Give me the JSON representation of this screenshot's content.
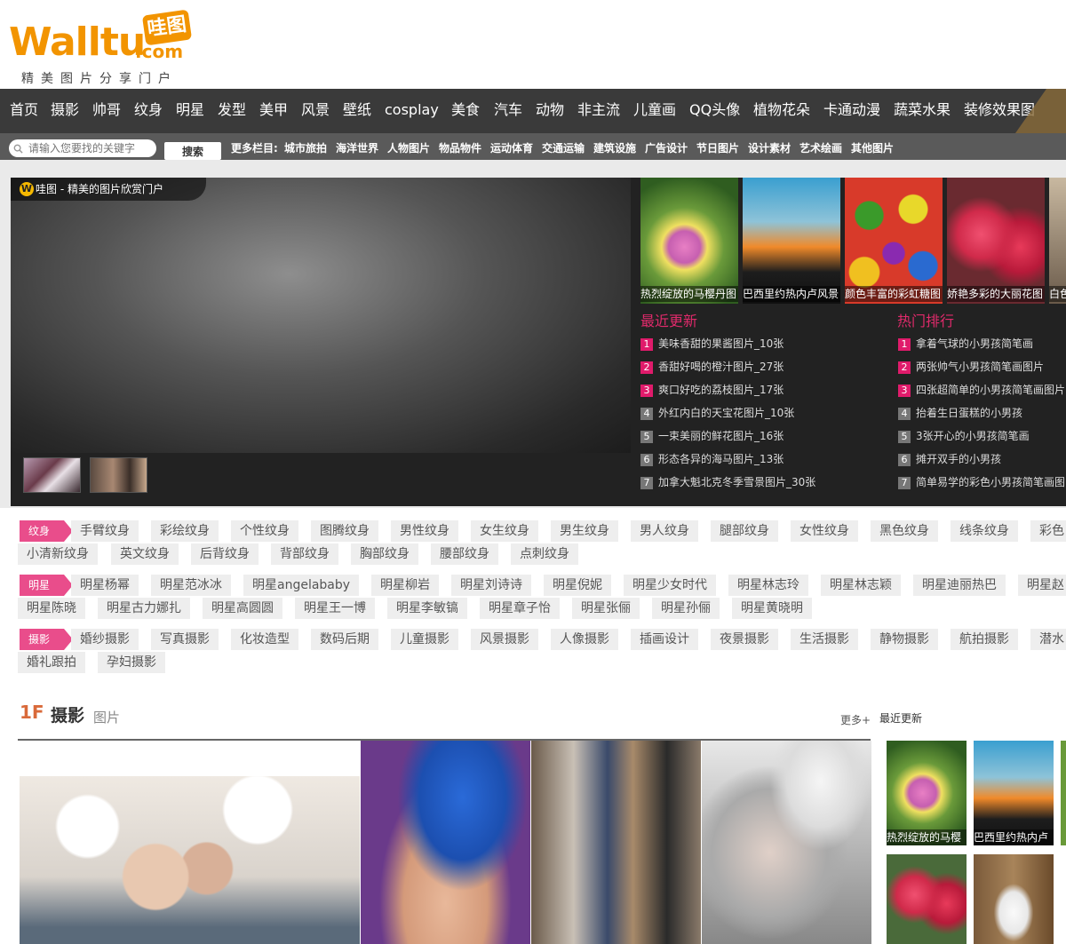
{
  "logo": {
    "word": "Walltu",
    "com": ".com",
    "badge": "哇图",
    "slogan": "精美图片分享门户"
  },
  "nav": {
    "items": [
      "首页",
      "摄影",
      "帅哥",
      "纹身",
      "明星",
      "发型",
      "美甲",
      "风景",
      "壁纸",
      "cosplay",
      "美食",
      "汽车",
      "动物",
      "非主流",
      "儿童画",
      "QQ头像",
      "植物花朵",
      "卡通动漫",
      "蔬菜水果",
      "装修效果图"
    ]
  },
  "search": {
    "placeholder": "请输入您要找的关键字",
    "button": "搜索"
  },
  "more": {
    "label": "更多栏目:",
    "links": [
      "城市旅拍",
      "海洋世界",
      "人物图片",
      "物品物件",
      "运动体育",
      "交通运输",
      "建筑设施",
      "广告设计",
      "节日图片",
      "设计素材",
      "艺术绘画",
      "其他图片"
    ]
  },
  "featured": {
    "badge": "W",
    "title": "哇图 - 精美的图片欣赏门户"
  },
  "top_cards": [
    {
      "caption": "热烈绽放的马樱丹图"
    },
    {
      "caption": "巴西里约热内卢风景"
    },
    {
      "caption": "颜色丰富的彩虹糖图"
    },
    {
      "caption": "娇艳多彩的大丽花图"
    },
    {
      "caption": "白色"
    }
  ],
  "latest": {
    "title": "最近更新",
    "items": [
      "美味香甜的果酱图片_10张",
      "香甜好喝的橙汁图片_27张",
      "爽口好吃的荔枝图片_17张",
      "外红内白的天宝花图片_10张",
      "一束美丽的鲜花图片_16张",
      "形态各异的海马图片_13张",
      "加拿大魁北克冬季雪景图片_30张"
    ],
    "nums": [
      "1",
      "2",
      "3",
      "4",
      "5",
      "6",
      "7"
    ]
  },
  "hot": {
    "title": "热门排行",
    "items": [
      "拿着气球的小男孩简笔画",
      "两张帅气小男孩简笔画图片",
      "四张超简单的小男孩简笔画图片",
      "抬着生日蛋糕的小男孩",
      "3张开心的小男孩简笔画",
      "摊开双手的小男孩",
      "简单易学的彩色小男孩简笔画图"
    ]
  },
  "tag_groups": [
    {
      "label": "纹身",
      "row1": [
        "手臂纹身",
        "彩绘纹身",
        "个性纹身",
        "图腾纹身",
        "男性纹身",
        "女生纹身",
        "男生纹身",
        "男人纹身",
        "腿部纹身",
        "女性纹身",
        "黑色纹身",
        "线条纹身",
        "彩色"
      ],
      "row2": [
        "小清新纹身",
        "英文纹身",
        "后背纹身",
        "背部纹身",
        "胸部纹身",
        "腰部纹身",
        "点刺纹身"
      ]
    },
    {
      "label": "明星",
      "row1": [
        "明星杨幂",
        "明星范冰冰",
        "明星angelababy",
        "明星柳岩",
        "明星刘诗诗",
        "明星倪妮",
        "明星少女时代",
        "明星林志玲",
        "明星林志颖",
        "明星迪丽热巴",
        "明星赵"
      ],
      "row2": [
        "明星陈晓",
        "明星古力娜扎",
        "明星高圆圆",
        "明星王一博",
        "明星李敏镐",
        "明星章子怡",
        "明星张俪",
        "明星孙俪",
        "明星黄晓明"
      ]
    },
    {
      "label": "摄影",
      "row1": [
        "婚纱摄影",
        "写真摄影",
        "化妆造型",
        "数码后期",
        "儿童摄影",
        "风景摄影",
        "人像摄影",
        "插画设计",
        "夜景摄影",
        "生活摄影",
        "静物摄影",
        "航拍摄影",
        "潜水"
      ],
      "row2": [
        "婚礼跟拍",
        "孕妇摄影"
      ]
    }
  ],
  "floor": {
    "num": "1F",
    "name": "摄影",
    "sub": "图片",
    "more": "更多+",
    "recent": "最近更新"
  },
  "floor_recent": [
    {
      "caption": "热烈绽放的马樱"
    },
    {
      "caption": "巴西里约热内卢"
    }
  ],
  "colors": {
    "accent": "#e01b6b",
    "nav_bg": "#3a3a3a",
    "logo": "#f29400",
    "floor": "#d96a3a"
  }
}
